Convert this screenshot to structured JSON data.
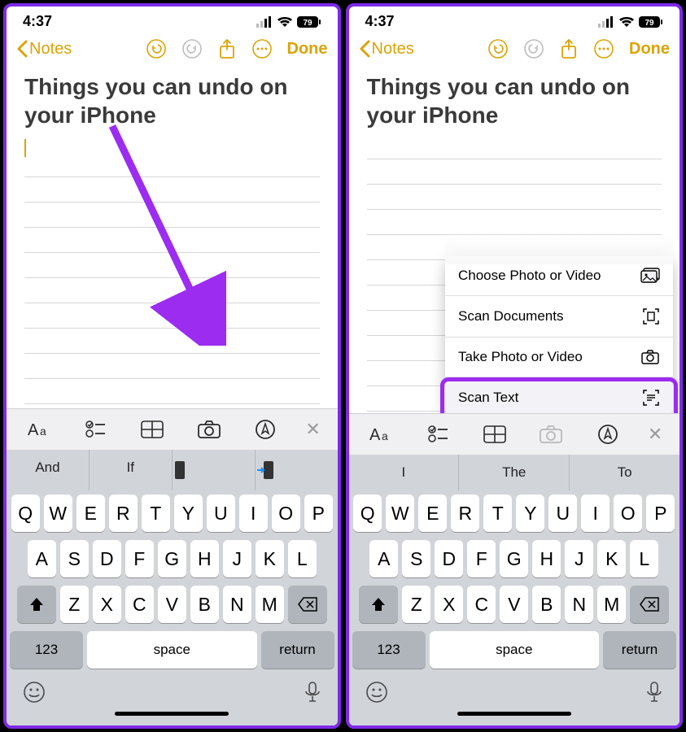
{
  "status": {
    "time": "4:37",
    "battery": "79"
  },
  "nav": {
    "back_label": "Notes",
    "done_label": "Done"
  },
  "note": {
    "title": "Things you can undo on your iPhone"
  },
  "popup": {
    "items": [
      {
        "label": "Choose Photo or Video"
      },
      {
        "label": "Scan Documents"
      },
      {
        "label": "Take Photo or Video"
      },
      {
        "label": "Scan Text"
      }
    ]
  },
  "suggestions_left": [
    "And",
    "If"
  ],
  "suggestions_right": [
    "I",
    "The",
    "To"
  ],
  "keyboard": {
    "row1": [
      "Q",
      "W",
      "E",
      "R",
      "T",
      "Y",
      "U",
      "I",
      "O",
      "P"
    ],
    "row2": [
      "A",
      "S",
      "D",
      "F",
      "G",
      "H",
      "J",
      "K",
      "L"
    ],
    "row3": [
      "Z",
      "X",
      "C",
      "V",
      "B",
      "N",
      "M"
    ],
    "numbers_label": "123",
    "space_label": "space",
    "return_label": "return"
  }
}
